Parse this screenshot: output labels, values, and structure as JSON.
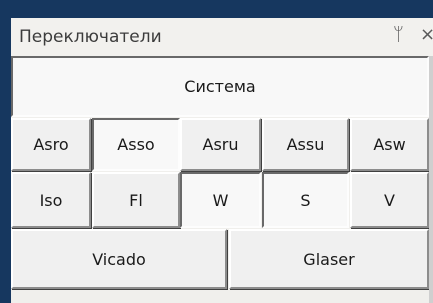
{
  "window": {
    "title": "Переключатели",
    "pin_icon": "pin-icon",
    "close_icon": "close-icon",
    "pin_glyph": "ᛘ",
    "close_glyph": "×"
  },
  "buttons": {
    "system": {
      "label": "Система",
      "pressed": true
    },
    "row1": [
      {
        "label": "Asro",
        "pressed": false
      },
      {
        "label": "Asso",
        "pressed": true
      },
      {
        "label": "Asru",
        "pressed": false
      },
      {
        "label": "Assu",
        "pressed": false
      },
      {
        "label": "Asw",
        "pressed": false
      }
    ],
    "row2": [
      {
        "label": "Iso",
        "pressed": false
      },
      {
        "label": "Fl",
        "pressed": false
      },
      {
        "label": "W",
        "pressed": true
      },
      {
        "label": "S",
        "pressed": true
      },
      {
        "label": "V",
        "pressed": false
      }
    ],
    "row3": [
      {
        "label": "Vicado",
        "pressed": false
      },
      {
        "label": "Glaser",
        "pressed": false
      }
    ]
  },
  "colors": {
    "background": "#16375f",
    "panel": "#f0efec",
    "button_face": "#f0f0f0",
    "button_pressed": "#f8f8f8"
  }
}
